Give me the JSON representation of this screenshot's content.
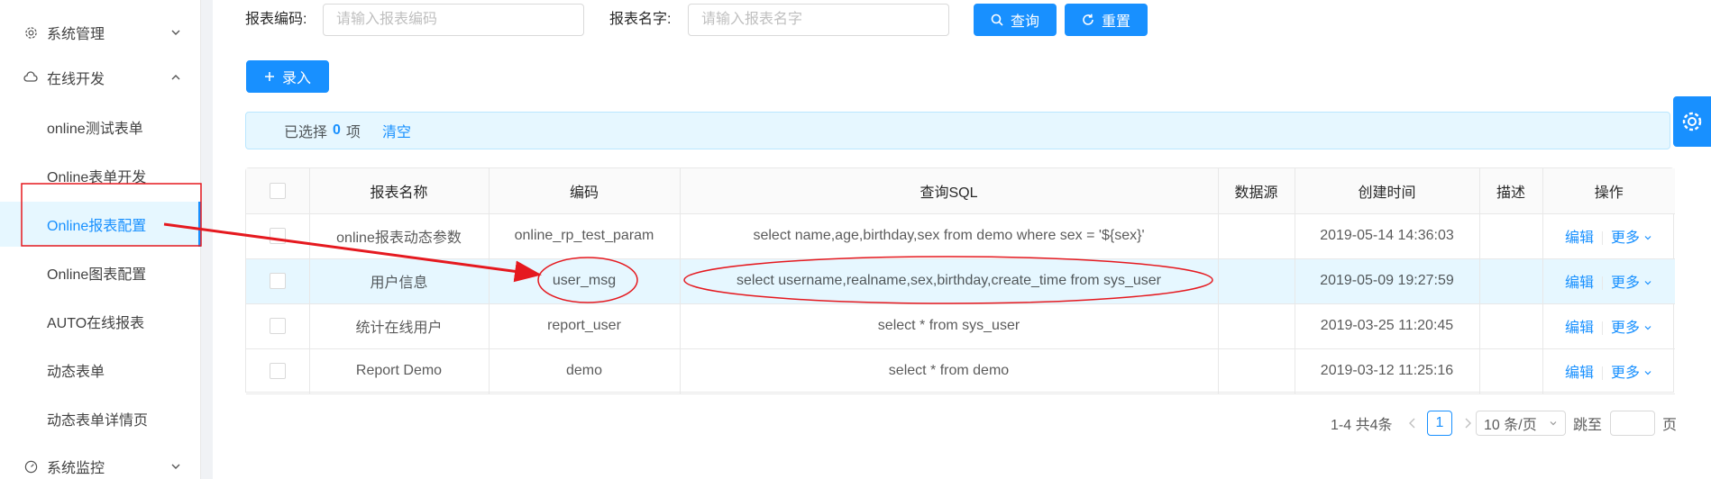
{
  "sidebar": {
    "groups": [
      {
        "label": "系统管理",
        "icon": "gear-icon",
        "expanded": false
      },
      {
        "label": "在线开发",
        "icon": "cloud-icon",
        "expanded": true
      },
      {
        "label": "系统监控",
        "icon": "dashboard-icon",
        "expanded": false
      }
    ],
    "items": [
      {
        "label": "online测试表单"
      },
      {
        "label": "Online表单开发"
      },
      {
        "label": "Online报表配置",
        "active": true
      },
      {
        "label": "Online图表配置"
      },
      {
        "label": "AUTO在线报表"
      },
      {
        "label": "动态表单"
      },
      {
        "label": "动态表单详情页"
      }
    ]
  },
  "search": {
    "code_label": "报表编码:",
    "code_placeholder": "请输入报表编码",
    "code_value": "",
    "name_label": "报表名字:",
    "name_placeholder": "请输入报表名字",
    "name_value": "",
    "query_label": "查询",
    "reset_label": "重置"
  },
  "toolbar": {
    "add_label": "录入"
  },
  "alert": {
    "prefix": "已选择",
    "count": "0",
    "suffix": "项",
    "clear_label": "清空"
  },
  "table": {
    "columns": [
      "报表名称",
      "编码",
      "查询SQL",
      "数据源",
      "创建时间",
      "描述",
      "操作"
    ],
    "rows": [
      {
        "name": "online报表动态参数",
        "code": "online_rp_test_param",
        "sql": "select name,age,birthday,sex from demo where sex = '${sex}'",
        "datasource": "",
        "created": "2019-05-14 14:36:03",
        "desc": "",
        "edit": "编辑",
        "more": "更多"
      },
      {
        "name": "用户信息",
        "code": "user_msg",
        "sql": "select username,realname,sex,birthday,create_time from sys_user",
        "datasource": "",
        "created": "2019-05-09 19:27:59",
        "desc": "",
        "edit": "编辑",
        "more": "更多"
      },
      {
        "name": "统计在线用户",
        "code": "report_user",
        "sql": "select * from sys_user",
        "datasource": "",
        "created": "2019-03-25 11:20:45",
        "desc": "",
        "edit": "编辑",
        "more": "更多"
      },
      {
        "name": "Report Demo",
        "code": "demo",
        "sql": "select * from demo",
        "datasource": "",
        "created": "2019-03-12 11:25:16",
        "desc": "",
        "edit": "编辑",
        "more": "更多"
      }
    ]
  },
  "pagination": {
    "total": "1-4 共4条",
    "current_page": "1",
    "page_size": "10 条/页",
    "jump_label": "跳至",
    "jump_value": "",
    "page_suffix": "页"
  },
  "colors": {
    "primary": "#1890ff",
    "annotation": "#e5191f"
  }
}
